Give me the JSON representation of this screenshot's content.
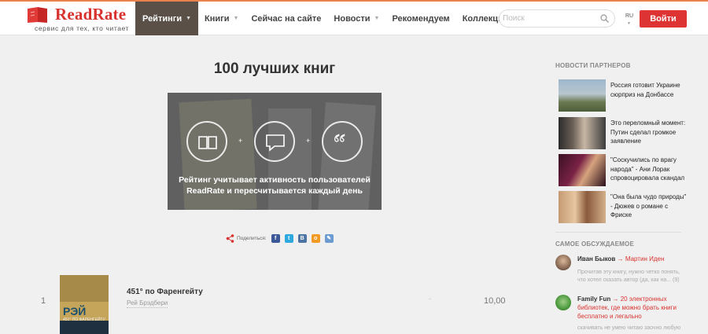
{
  "logo": {
    "text": "ReadRate",
    "tagline": "сервис для тех, кто читает"
  },
  "nav": [
    {
      "label": "Рейтинги",
      "active": true,
      "caret": true
    },
    {
      "label": "Книги",
      "caret": true
    },
    {
      "label": "Сейчас на сайте"
    },
    {
      "label": "Новости",
      "caret": true
    },
    {
      "label": "Рекомендуем"
    },
    {
      "label": "Коллекции"
    }
  ],
  "search": {
    "placeholder": "Поиск"
  },
  "lang": "RU",
  "login_label": "Войти",
  "page_title": "100 лучших книг",
  "banner_text": "Рейтинг учитывает активность пользователей ReadRate и пересчитывается каждый день",
  "share": {
    "label": "Поделиться:",
    "buttons": [
      {
        "name": "facebook",
        "glyph": "f",
        "color": "#3b5998"
      },
      {
        "name": "twitter",
        "glyph": "t",
        "color": "#2ea9df"
      },
      {
        "name": "vk",
        "glyph": "B",
        "color": "#4c75a3"
      },
      {
        "name": "odnoklassniki",
        "glyph": "o",
        "color": "#f19b26"
      },
      {
        "name": "livejournal",
        "glyph": "✎",
        "color": "#6c9bd2"
      }
    ]
  },
  "books": [
    {
      "rank": "1",
      "title": "451° по Фаренгейту",
      "author": "Рей Брэдбери",
      "score": "10,00",
      "rating_placeholder": "-",
      "cover_title": "РЭЙ",
      "cover_sub": "451° ПО ФАРЕНГЕЙТУ"
    }
  ],
  "partner_news": {
    "heading": "НОВОСТИ ПАРТНЕРОВ",
    "items": [
      {
        "text": "Россия готовит Украине сюрприз на Донбассе"
      },
      {
        "text": "Это переломный момент: Путин сделал громкое заявление"
      },
      {
        "text": "\"Соскучились по врагу народа\" - Ани Лорак спровоцировала скандал"
      },
      {
        "text": "\"Она была чудо природы\" - Дюжев о романе с Фриске"
      }
    ]
  },
  "discussed": {
    "heading": "САМОЕ ОБСУЖДАЕМОЕ",
    "items": [
      {
        "user": "Иван Быков",
        "arrow": "→",
        "book": "Мартин Иден",
        "snippet": "Прочитав эту книгу, нужно четко понять, что хотел сказать автор (да, как на... (9)"
      },
      {
        "user": "Family Fun",
        "arrow": "→",
        "book": "20 электронных библиотек, где можно брать книги бесплатно и легально",
        "snippet": "скачивать не умею читаю заочно любую"
      }
    ]
  }
}
